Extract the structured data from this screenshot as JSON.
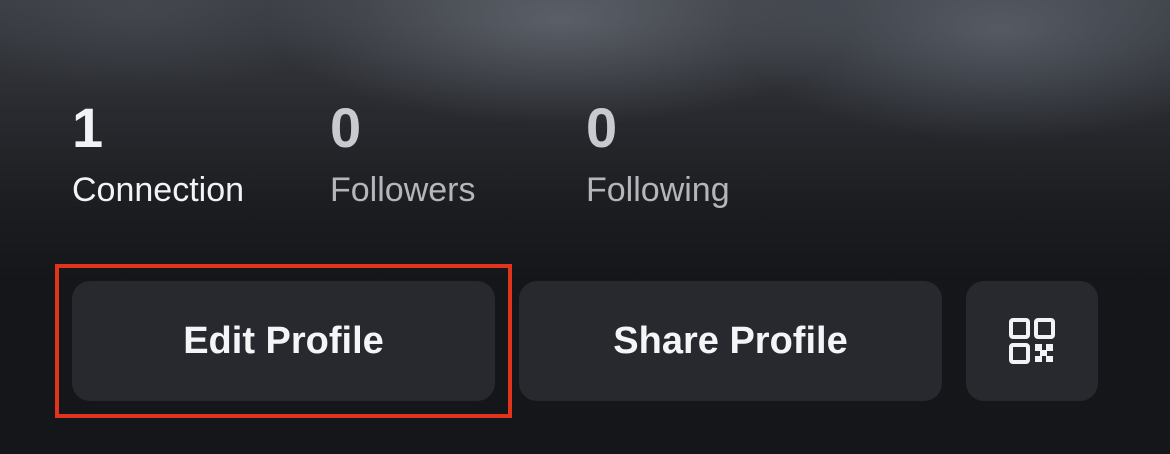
{
  "stats": [
    {
      "count": "1",
      "label": "Connection"
    },
    {
      "count": "0",
      "label": "Followers"
    },
    {
      "count": "0",
      "label": "Following"
    }
  ],
  "actions": {
    "edit_profile_label": "Edit Profile",
    "share_profile_label": "Share Profile",
    "qr_icon": "qr-code-icon"
  },
  "highlight_color": "#e0341c"
}
